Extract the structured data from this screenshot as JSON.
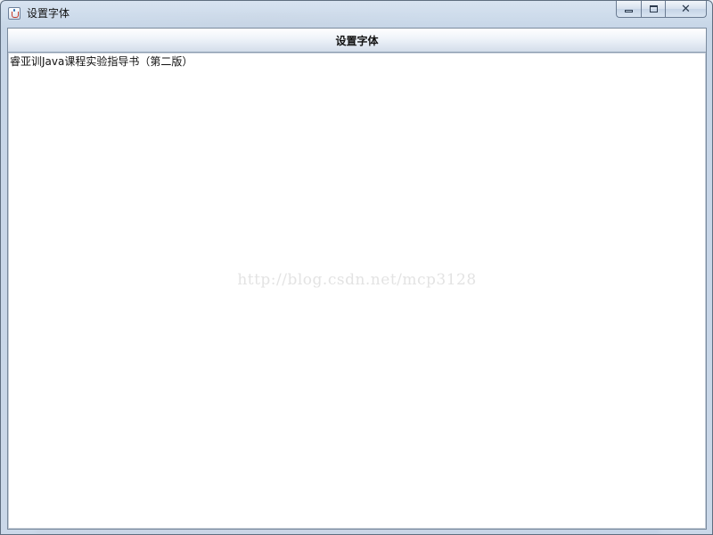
{
  "window": {
    "title": "设置字体",
    "controls": {
      "minimize_icon": "minimize-icon",
      "maximize_icon": "maximize-icon",
      "close_icon": "close-icon",
      "close_glyph": "✕"
    }
  },
  "toolbar": {
    "font_button_label": "设置字体"
  },
  "editor": {
    "text": "睿亚训Java课程实验指导书（第二版）"
  },
  "watermark": {
    "text": "http://blog.csdn.net/mcp3128"
  },
  "colors": {
    "frame": "#c4d4e6",
    "client_background": "#ffffff",
    "button_gradient_bottom": "#d3ddea"
  }
}
